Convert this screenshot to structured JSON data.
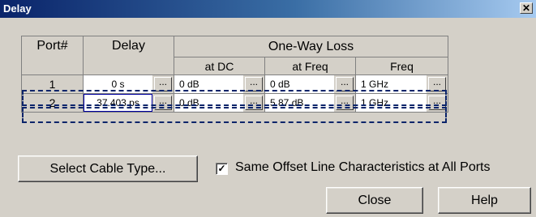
{
  "window": {
    "title": "Delay",
    "close_glyph": "✕"
  },
  "table": {
    "headers": {
      "port": "Port#",
      "delay": "Delay",
      "loss": "One-Way Loss"
    },
    "subheaders": {
      "at_dc": "at DC",
      "at_freq": "at Freq",
      "freq": "Freq"
    },
    "rows": [
      {
        "port": "1",
        "delay": "0 s",
        "at_dc": "0 dB",
        "at_freq": "0 dB",
        "freq": "1 GHz"
      },
      {
        "port": "2",
        "delay": "37.403 ps",
        "at_dc": "0 dB",
        "at_freq": "5.87 dB",
        "freq": "1 GHz"
      }
    ],
    "ellipsis": "..."
  },
  "buttons": {
    "select_cable": "Select Cable Type...",
    "close": "Close",
    "help": "Help"
  },
  "checkbox": {
    "label": "Same Offset Line Characteristics at All Ports",
    "checked": true,
    "glyph": "✓"
  }
}
